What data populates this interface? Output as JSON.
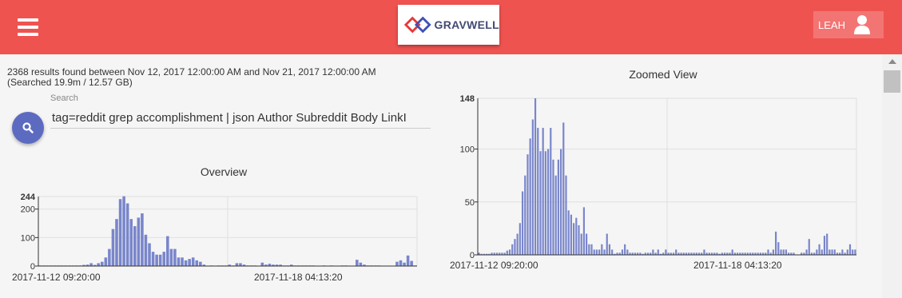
{
  "header": {
    "menu_icon": "hamburger-icon",
    "logo_text": "GRAVWELL",
    "user_name": "LEAH",
    "user_icon": "user-icon",
    "bar_color": "#ef5350"
  },
  "summary": {
    "line1": "2368 results found between Nov 12, 2017 12:00:00 AM and Nov 21, 2017 12:00:00 AM",
    "line2": "(Searched 19.9m / 12.57 GB)"
  },
  "search": {
    "label": "Search",
    "value": "tag=reddit grep accomplishment | json Author Subreddit Body LinkI",
    "button_icon": "search-icon"
  },
  "chart_data": [
    {
      "type": "bar",
      "title": "Overview",
      "color": "#7986cb",
      "ylim": [
        0,
        244
      ],
      "yticks": [
        0,
        100,
        200
      ],
      "ymax_label": "244",
      "xtick_labels": [
        "2017-11-12 09:20:00",
        "2017-11-18 04:13:20"
      ],
      "grid": true,
      "values": [
        2,
        2,
        2,
        2,
        2,
        2,
        2,
        2,
        2,
        2,
        2,
        2,
        4,
        5,
        10,
        4,
        10,
        15,
        30,
        60,
        130,
        165,
        235,
        245,
        220,
        165,
        140,
        170,
        185,
        110,
        80,
        50,
        40,
        40,
        50,
        105,
        60,
        60,
        30,
        30,
        20,
        25,
        30,
        20,
        15,
        5,
        0,
        2,
        0,
        2,
        2,
        2,
        5,
        2,
        10,
        10,
        5,
        2,
        2,
        2,
        1,
        12,
        5,
        8,
        5,
        5,
        5,
        2,
        2,
        5,
        2,
        2,
        2,
        2,
        2,
        2,
        0,
        0,
        2,
        0,
        2,
        0,
        0,
        2,
        2,
        0,
        0,
        22,
        12,
        5,
        2,
        2,
        2,
        2,
        0,
        0,
        0,
        0,
        15,
        20,
        12,
        37,
        18,
        2
      ]
    },
    {
      "type": "bar",
      "title": "Zoomed View",
      "color": "#7986cb",
      "ylim": [
        0,
        148
      ],
      "yticks": [
        0,
        50,
        100
      ],
      "ymax_label": "148",
      "xtick_labels": [
        "2017-11-12 09:20:00",
        "2017-11-18 04:13:20"
      ],
      "grid": true,
      "values": [
        2,
        1,
        1,
        1,
        1,
        2,
        2,
        2,
        2,
        2,
        2,
        4,
        5,
        10,
        15,
        20,
        30,
        60,
        75,
        95,
        110,
        128,
        148,
        120,
        98,
        120,
        98,
        100,
        120,
        90,
        75,
        90,
        100,
        125,
        75,
        42,
        38,
        30,
        35,
        28,
        20,
        45,
        20,
        10,
        10,
        5,
        5,
        5,
        10,
        5,
        20,
        10,
        5,
        1,
        2,
        2,
        5,
        10,
        5,
        2,
        2,
        2,
        2,
        2,
        1,
        2,
        2,
        2,
        5,
        2,
        5,
        1,
        2,
        5,
        2,
        2,
        2,
        5,
        2,
        2,
        2,
        2,
        2,
        2,
        2,
        2,
        2,
        2,
        5,
        2,
        2,
        2,
        2,
        2,
        1,
        2,
        2,
        2,
        2,
        5,
        2,
        2,
        2,
        2,
        2,
        2,
        2,
        2,
        2,
        2,
        2,
        2,
        2,
        5,
        2,
        5,
        22,
        12,
        5,
        5,
        5,
        2,
        2,
        2,
        0,
        0,
        2,
        2,
        5,
        15,
        2,
        2,
        5,
        10,
        5,
        18,
        20,
        5,
        5,
        5,
        2,
        2,
        5,
        2,
        5,
        10,
        5,
        5
      ]
    }
  ]
}
